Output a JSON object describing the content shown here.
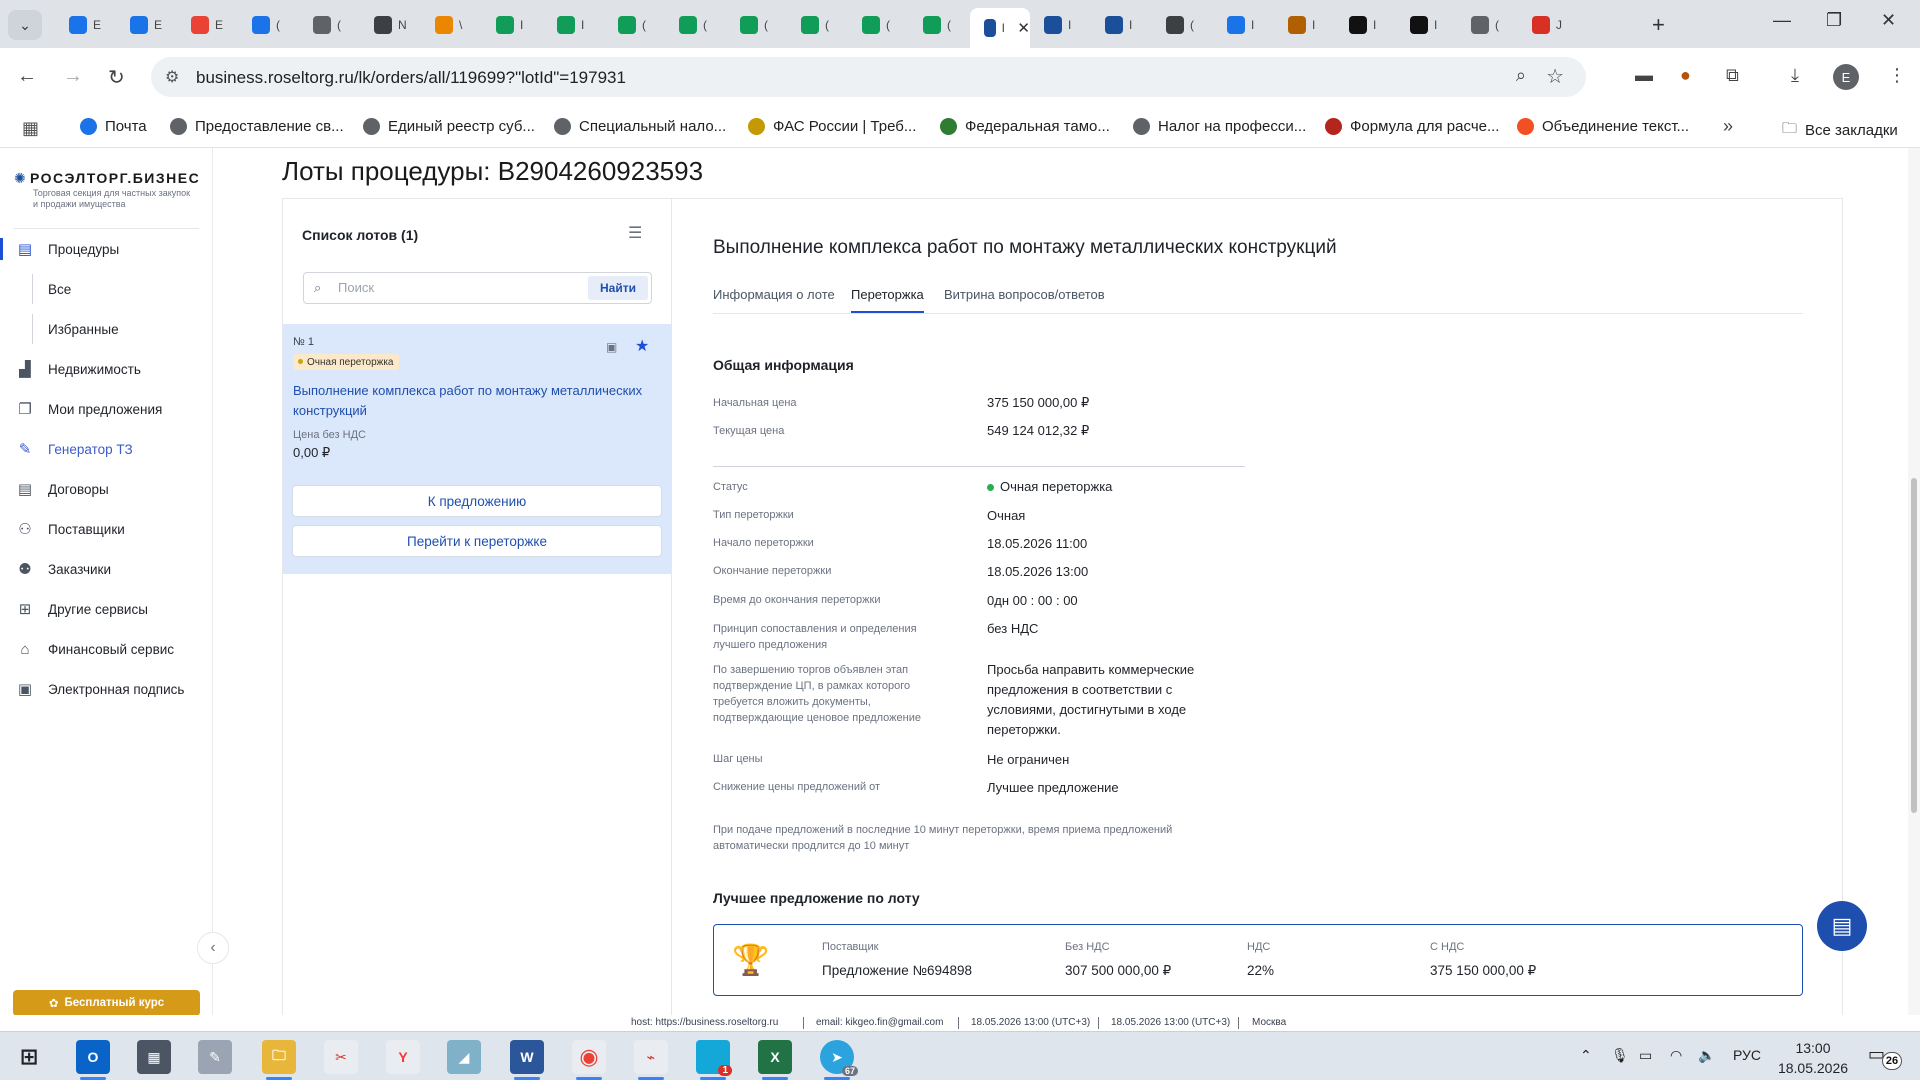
{
  "browser": {
    "url": "business.roseltorg.ru/lk/orders/all/119699?\"lotId\"=197931",
    "tabs": [
      {
        "label": "E",
        "icon": "mail-icon",
        "color": "#1a73e8"
      },
      {
        "label": "E",
        "icon": "mail-icon",
        "color": "#1a73e8"
      },
      {
        "label": "E",
        "icon": "gmail-icon",
        "color": "#ea4335"
      },
      {
        "label": "(",
        "icon": "site-icon",
        "color": "#1a73e8"
      },
      {
        "label": "(",
        "icon": "site-icon",
        "color": "#5f6368"
      },
      {
        "label": "N",
        "icon": "site-icon",
        "color": "#3c4043"
      },
      {
        "label": "\\",
        "icon": "site-icon",
        "color": "#ea8600"
      },
      {
        "label": "I",
        "icon": "sheets-icon",
        "color": "#0f9d58"
      },
      {
        "label": "I",
        "icon": "sheets-icon",
        "color": "#0f9d58"
      },
      {
        "label": "(",
        "icon": "sheets-icon",
        "color": "#0f9d58"
      },
      {
        "label": "(",
        "icon": "sheets-icon",
        "color": "#0f9d58"
      },
      {
        "label": "(",
        "icon": "sheets-icon",
        "color": "#0f9d58"
      },
      {
        "label": "(",
        "icon": "sheets-icon",
        "color": "#0f9d58"
      },
      {
        "label": "(",
        "icon": "sheets-icon",
        "color": "#0f9d58"
      },
      {
        "label": "(",
        "icon": "site-icon",
        "color": "#0f9d58"
      }
    ],
    "active_tab": {
      "label": "I",
      "icon": "roseltorg-icon",
      "color": "#1b4f9a"
    },
    "tabs_after": [
      {
        "label": "I",
        "icon": "site-icon",
        "color": "#1b4f9a"
      },
      {
        "label": "I",
        "icon": "site-icon",
        "color": "#1b4f9a"
      },
      {
        "label": "(",
        "icon": "site-icon",
        "color": "#3c4043"
      },
      {
        "label": "I",
        "icon": "site-icon",
        "color": "#1a73e8"
      },
      {
        "label": "I",
        "icon": "site-icon",
        "color": "#b06000"
      },
      {
        "label": "I",
        "icon": "site-icon",
        "color": "#111111"
      },
      {
        "label": "I",
        "icon": "site-icon",
        "color": "#111111"
      },
      {
        "label": "(",
        "icon": "site-icon",
        "color": "#5f6368"
      },
      {
        "label": "J",
        "icon": "site-icon",
        "color": "#d93025"
      }
    ],
    "profile_initial": "E",
    "bookmarks": [
      {
        "label": "Почта",
        "color": "#1a73e8"
      },
      {
        "label": "Предоставление св...",
        "color": "#5f6368"
      },
      {
        "label": "Единый реестр суб...",
        "color": "#5f6368"
      },
      {
        "label": "Специальный нало...",
        "color": "#5f6368"
      },
      {
        "label": "ФАС России | Треб...",
        "color": "#c49a00"
      },
      {
        "label": "Федеральная тамо...",
        "color": "#2e7d32"
      },
      {
        "label": "Налог на професси...",
        "color": "#5f6368"
      },
      {
        "label": "Формула для расче...",
        "color": "#b3261e"
      },
      {
        "label": "Объединение текст...",
        "color": "#f25022"
      }
    ],
    "all_bookmarks": "Все закладки"
  },
  "logo": {
    "name": "РОСЭЛТОРГ.БИЗНЕС",
    "subtitle": "Торговая секция для частных закупок и продажи имущества"
  },
  "sidebar": {
    "items": [
      {
        "label": "Процедуры",
        "icon": "document-icon"
      },
      {
        "label": "Все",
        "sub": true
      },
      {
        "label": "Избранные",
        "sub": true
      },
      {
        "label": "Недвижимость",
        "icon": "building-icon"
      },
      {
        "label": "Мои предложения",
        "icon": "offers-icon"
      },
      {
        "label": "Генератор ТЗ",
        "icon": "generator-icon"
      },
      {
        "label": "Договоры",
        "icon": "contract-icon"
      },
      {
        "label": "Поставщики",
        "icon": "suppliers-icon"
      },
      {
        "label": "Заказчики",
        "icon": "customers-icon"
      },
      {
        "label": "Другие сервисы",
        "icon": "grid-icon"
      },
      {
        "label": "Финансовый сервис",
        "icon": "bank-icon"
      },
      {
        "label": "Электронная подпись",
        "icon": "signature-icon"
      }
    ],
    "course_button": "Бесплатный курс"
  },
  "page": {
    "title": "Лоты процедуры: В2904260923593"
  },
  "lot_list": {
    "header": "Список лотов (1)",
    "search_placeholder": "Поиск",
    "search_button": "Найти",
    "lot": {
      "number": "№ 1",
      "badge": "Очная переторжка",
      "title": "Выполнение комплекса работ по монтажу металлических конструкций",
      "price_label": "Цена без НДС",
      "price_value": "0,00 ₽"
    },
    "btn_offer": "К предложению",
    "btn_rebid": "Перейти к переторжке"
  },
  "detail": {
    "title": "Выполнение комплекса работ по монтажу металлических конструкций",
    "tabs": [
      "Информация о лоте",
      "Переторжка",
      "Витрина вопросов/ответов"
    ],
    "active_tab": "Переторжка",
    "section_general": "Общая информация",
    "rows": [
      {
        "label": "Начальная цена",
        "value": "375 150 000,00 ₽"
      },
      {
        "label": "Текущая цена",
        "value": "549 124 012,32 ₽"
      },
      {
        "label": "Статус",
        "value": "Очная переторжка"
      },
      {
        "label": "Тип переторжки",
        "value": "Очная"
      },
      {
        "label": "Начало переторжки",
        "value": "18.05.2026 11:00"
      },
      {
        "label": "Окончание переторжки",
        "value": "18.05.2026 13:00"
      },
      {
        "label": "Время до окончания переторжки",
        "value": "0дн 00 : 00 : 00"
      },
      {
        "label": "Принцип сопоставления и определения лучшего предложения",
        "value": "без НДС"
      },
      {
        "label": "По завершению торгов объявлен этап подтверждение ЦП, в рамках которого требуется вложить документы, подтверждающие ценовое предложение",
        "value": "Просьба направить коммерческие предложения в соответствии с условиями, достигнутыми в ходе переторжки."
      },
      {
        "label": "Шаг цены",
        "value": "Не ограничен"
      },
      {
        "label": "Снижение цены предложений от",
        "value": "Лучшее предложение"
      }
    ],
    "note": "При подаче предложений в последние 10 минут переторжки, время приема предложений автоматически продлится до 10 минут",
    "section_best": "Лучшее предложение по лоту",
    "best": {
      "supplier_label": "Поставщик",
      "supplier_value": "Предложение №694898",
      "novat_label": "Без НДС",
      "novat_value": "307 500 000,00 ₽",
      "vat_label": "НДС",
      "vat_value": "22%",
      "withvat_label": "С НДС",
      "withvat_value": "375 150 000,00 ₽"
    }
  },
  "status_strip": {
    "host": "host: https://business.roseltorg.ru",
    "email": "email: kikgeo.fin@gmail.com",
    "time1": "18.05.2026 13:00 (UTC+3)",
    "time2": "18.05.2026 13:00 (UTC+3)",
    "city": "Москва"
  },
  "taskbar": {
    "lang": "РУС",
    "time": "13:00",
    "date": "18.05.2026",
    "notifications": "26",
    "telegram_badge": "67",
    "mail_badge": "1"
  }
}
